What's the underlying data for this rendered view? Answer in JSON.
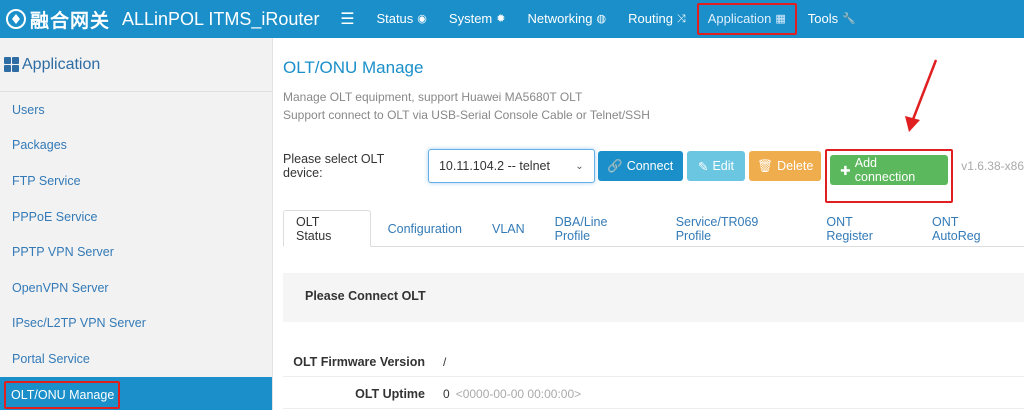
{
  "brand": {
    "cn": "融合网关",
    "en": "ALLinPOL ITMS_iRouter"
  },
  "nav": {
    "items": [
      {
        "label": "Status",
        "icon": "eye-icon",
        "glyph": "◉"
      },
      {
        "label": "System",
        "icon": "gear-icon",
        "glyph": "✹"
      },
      {
        "label": "Networking",
        "icon": "globe-icon",
        "glyph": "◍"
      },
      {
        "label": "Routing",
        "icon": "shuffle-icon",
        "glyph": "⤨"
      },
      {
        "label": "Application",
        "icon": "grid-icon",
        "glyph": "▦"
      },
      {
        "label": "Tools",
        "icon": "wrench-icon",
        "glyph": "🔧"
      }
    ],
    "active": "Application"
  },
  "sidebar": {
    "title": "Application",
    "items": [
      {
        "label": "Users"
      },
      {
        "label": "Packages"
      },
      {
        "label": "FTP Service"
      },
      {
        "label": "PPPoE Service"
      },
      {
        "label": "PPTP VPN Server"
      },
      {
        "label": "OpenVPN Server"
      },
      {
        "label": "IPsec/L2TP VPN Server"
      },
      {
        "label": "Portal Service"
      },
      {
        "label": "OLT/ONU Manage"
      }
    ],
    "active": "OLT/ONU Manage"
  },
  "main": {
    "title": "OLT/ONU Manage",
    "desc_line1": "Manage OLT equipment, support Huawei MA5680T OLT",
    "desc_line2": "Support connect to OLT via USB-Serial Console Cable or Telnet/SSH",
    "select_label": "Please select OLT device:",
    "select_value": "10.11.104.2 -- telnet",
    "buttons": {
      "connect": "Connect",
      "edit": "Edit",
      "delete": "Delete",
      "add": "Add connection"
    },
    "version": "v1.6.38-x86",
    "tabs": [
      {
        "label": "OLT Status"
      },
      {
        "label": "Configuration"
      },
      {
        "label": "VLAN"
      },
      {
        "label": "DBA/Line Profile"
      },
      {
        "label": "Service/TR069 Profile"
      },
      {
        "label": "ONT Register"
      },
      {
        "label": "ONT AutoReg"
      }
    ],
    "active_tab": "OLT Status",
    "panel_title": "Please Connect OLT",
    "rows": [
      {
        "label": "OLT Firmware Version",
        "value": "/",
        "extra": ""
      },
      {
        "label": "OLT Uptime",
        "value": "0",
        "extra": "<0000-00-00 00:00:00>"
      }
    ]
  },
  "colors": {
    "primary": "#1a8fc9",
    "success": "#5cb85c",
    "warning": "#f0ad4e",
    "info": "#5bc0de",
    "highlight": "#e02020"
  }
}
